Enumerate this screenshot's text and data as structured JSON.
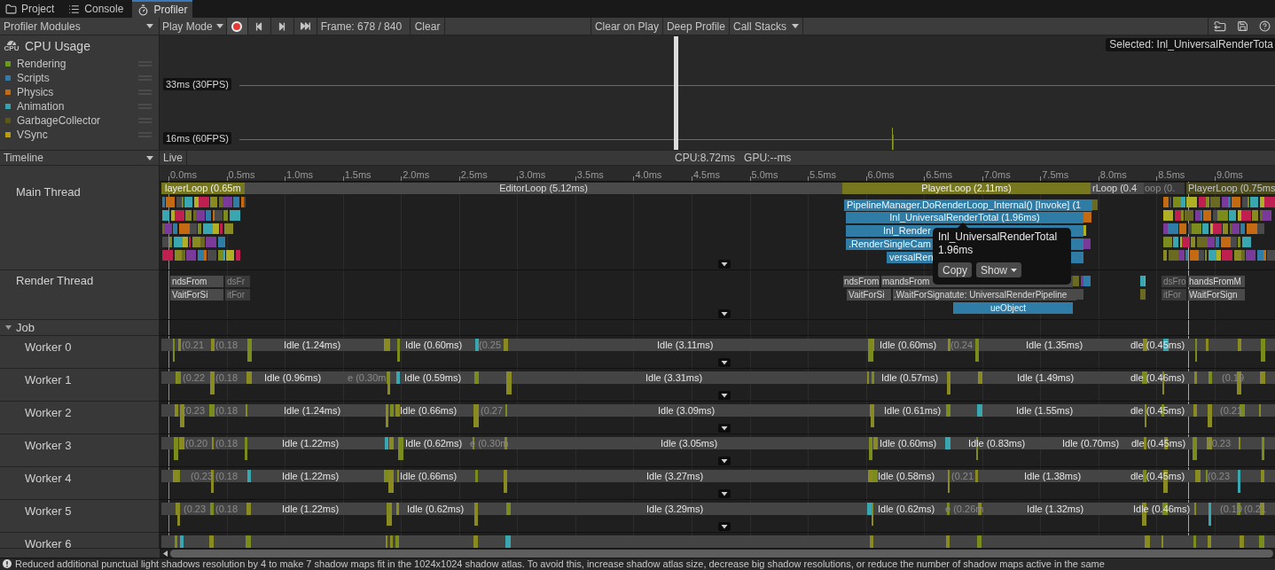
{
  "tabs": [
    {
      "label": "Project",
      "selected": false
    },
    {
      "label": "Console",
      "selected": false
    },
    {
      "label": "Profiler",
      "selected": true
    }
  ],
  "toolbar": {
    "modules": "Profiler Modules",
    "play_mode": "Play Mode",
    "record": {
      "on": true
    },
    "frame": "Frame: 678 / 840",
    "clear": "Clear",
    "buttons": [
      "Clear on Play",
      "Deep Profile"
    ],
    "call_stacks": "Call Stacks"
  },
  "cpu_module": {
    "icon_label": "CPU",
    "title": "CPU Usage",
    "categories": [
      {
        "name": "Rendering",
        "color": "#6a9a1c"
      },
      {
        "name": "Scripts",
        "color": "#2f7cab"
      },
      {
        "name": "Physics",
        "color": "#c46a12"
      },
      {
        "name": "Animation",
        "color": "#35a2ad"
      },
      {
        "name": "GarbageCollector",
        "color": "#5a5a16"
      },
      {
        "name": "VSync",
        "color": "#b89c14"
      }
    ]
  },
  "chart": {
    "markers": [
      "33ms (30FPS)",
      "16ms (60FPS)"
    ],
    "selected": "Selected: Inl_UniversalRenderTota"
  },
  "timeline": {
    "view": "Timeline",
    "mode": "Live",
    "cpu": "CPU:8.72ms",
    "gpu": "GPU:--ms",
    "ticks": [
      "0.0ms",
      "0.5ms",
      "1.0ms",
      "1.5ms",
      "2.0ms",
      "2.5ms",
      "3.0ms",
      "3.5ms",
      "4.0ms",
      "4.5ms",
      "5.0ms",
      "5.5ms",
      "6.0ms",
      "6.5ms",
      "7.0ms",
      "7.5ms",
      "8.0ms",
      "8.5ms",
      "9.0ms"
    ]
  },
  "threads": [
    {
      "name": "Main Thread",
      "rows": [
        {
          "blocks": [
            {
              "label": "layerLoop (0.65m",
              "kind": "player"
            },
            {
              "label": "EditorLoop (5.12ms)",
              "kind": "editor"
            },
            {
              "label": "PlayerLoop (2.11ms)",
              "kind": "player"
            },
            {
              "label": "rLoop (0.4",
              "kind": "editor"
            },
            {
              "label": "oop (0.",
              "kind": "dim"
            },
            {
              "label": "PlayerLoop (0.75ms",
              "kind": "faded"
            }
          ]
        },
        {
          "blocks": [
            {
              "label": "PipelineManager.DoRenderLoop_Internal() [Invoke] (1",
              "kind": "render"
            }
          ]
        },
        {
          "blocks": [
            {
              "label": "Inl_UniversalRenderTotal (1.96ms)",
              "kind": "render"
            }
          ]
        },
        {
          "blocks": [
            {
              "label": "Inl_Render",
              "kind": "render"
            }
          ]
        },
        {
          "blocks": [
            {
              "label": ".RenderSingleCam",
              "kind": "render"
            }
          ]
        },
        {
          "blocks": [
            {
              "label": "versalRen",
              "kind": "render"
            }
          ]
        }
      ]
    },
    {
      "name": "Render Thread",
      "rows": [
        {
          "blocks": [
            {
              "label": "ndsFrom",
              "kind": "editor"
            },
            {
              "label": "dsFr",
              "kind": "dim"
            },
            {
              "label": "ndsFrom",
              "kind": "editor"
            },
            {
              "label": "mandsFrom",
              "kind": "editor"
            },
            {
              "label": "dsFro",
              "kind": "dim"
            },
            {
              "label": "handsFromM",
              "kind": "editor"
            }
          ]
        },
        {
          "blocks": [
            {
              "label": "VaitForSi",
              "kind": "editor"
            },
            {
              "label": "itFor",
              "kind": "dim"
            },
            {
              "label": "VaitForSi",
              "kind": "editor"
            },
            {
              "label": ".WaitForSignatute: UniversalRenderPipeline",
              "kind": "editor"
            },
            {
              "label": "itFor",
              "kind": "dim"
            },
            {
              "label": "WaitForSign",
              "kind": "editor"
            }
          ]
        },
        {
          "blocks": [
            {
              "label": "ueObject",
              "kind": "render"
            }
          ]
        }
      ]
    }
  ],
  "job": {
    "name": "Job",
    "expanded": true,
    "workers": [
      {
        "name": "Worker 0",
        "labels": [
          {
            "text": "(0.21",
            "kind": "dim"
          },
          {
            "text": "(0.18",
            "kind": "dim"
          },
          {
            "text": "Idle (1.24ms)",
            "kind": "idle"
          },
          {
            "text": "Idle (0.60ms)",
            "kind": "idle"
          },
          {
            "text": "(0.25",
            "kind": "dim"
          },
          {
            "text": "Idle (3.11ms)",
            "kind": "idle"
          },
          {
            "text": "Idle (0.60ms)",
            "kind": "idle"
          },
          {
            "text": "(0.24",
            "kind": "dim"
          },
          {
            "text": "Idle (1.35ms)",
            "kind": "idle"
          },
          {
            "text": "dle (0.45ms)",
            "kind": "idle"
          }
        ]
      },
      {
        "name": "Worker 1",
        "labels": [
          {
            "text": "(0.22",
            "kind": "dim"
          },
          {
            "text": "(0.18",
            "kind": "dim"
          },
          {
            "text": "Idle (0.96ms)",
            "kind": "idle"
          },
          {
            "text": "e (0.30m",
            "kind": "dim"
          },
          {
            "text": "Idle (0.59ms)",
            "kind": "idle"
          },
          {
            "text": "Idle (3.31ms)",
            "kind": "idle"
          },
          {
            "text": "Idle (0.57ms)",
            "kind": "idle"
          },
          {
            "text": "Idle (1.49ms)",
            "kind": "idle"
          },
          {
            "text": "dle (0.46ms)",
            "kind": "idle"
          },
          {
            "text": "(0.19",
            "kind": "dim"
          }
        ]
      },
      {
        "name": "Worker 2",
        "labels": [
          {
            "text": "(0.23",
            "kind": "dim"
          },
          {
            "text": "(0.18",
            "kind": "dim"
          },
          {
            "text": "Idle (1.24ms)",
            "kind": "idle"
          },
          {
            "text": "Idle (0.66ms)",
            "kind": "idle"
          },
          {
            "text": "(0.27",
            "kind": "dim"
          },
          {
            "text": "Idle (3.09ms)",
            "kind": "idle"
          },
          {
            "text": "Idle (0.61ms)",
            "kind": "idle"
          },
          {
            "text": "Idle (1.55ms)",
            "kind": "idle"
          },
          {
            "text": "dle (0.45ms)",
            "kind": "idle"
          },
          {
            "text": "(0.21",
            "kind": "dim"
          }
        ]
      },
      {
        "name": "Worker 3",
        "labels": [
          {
            "text": "(0.20",
            "kind": "dim"
          },
          {
            "text": "(0.18",
            "kind": "dim"
          },
          {
            "text": "Idle (1.22ms)",
            "kind": "idle"
          },
          {
            "text": "Idle (0.62ms)",
            "kind": "idle"
          },
          {
            "text": "e (0.30m",
            "kind": "dim"
          },
          {
            "text": "Idle (3.05ms)",
            "kind": "idle"
          },
          {
            "text": "Idle (0.60ms)",
            "kind": "idle"
          },
          {
            "text": "Idle (0.83ms)",
            "kind": "idle"
          },
          {
            "text": "Idle (0.70ms)",
            "kind": "idle"
          },
          {
            "text": "dle (0.45ms)",
            "kind": "idle"
          },
          {
            "text": "(0.23",
            "kind": "dim"
          }
        ]
      },
      {
        "name": "Worker 4",
        "labels": [
          {
            "text": "(0.23",
            "kind": "dim"
          },
          {
            "text": "(0.18",
            "kind": "dim"
          },
          {
            "text": "Idle (1.22ms)",
            "kind": "idle"
          },
          {
            "text": "Idle (0.66ms)",
            "kind": "idle"
          },
          {
            "text": "Idle (3.27ms)",
            "kind": "idle"
          },
          {
            "text": "Idle (0.58ms)",
            "kind": "idle"
          },
          {
            "text": "(0.21",
            "kind": "dim"
          },
          {
            "text": "Idle (1.38ms)",
            "kind": "idle"
          },
          {
            "text": "dle (0.45ms)",
            "kind": "idle"
          },
          {
            "text": "(0.23",
            "kind": "dim"
          }
        ]
      },
      {
        "name": "Worker 5",
        "labels": [
          {
            "text": "(0.23",
            "kind": "dim"
          },
          {
            "text": "(0.18",
            "kind": "dim"
          },
          {
            "text": "Idle (1.22ms)",
            "kind": "idle"
          },
          {
            "text": "Idle (0.62ms)",
            "kind": "idle"
          },
          {
            "text": "Idle (3.29ms)",
            "kind": "idle"
          },
          {
            "text": "Idle (0.62ms)",
            "kind": "idle"
          },
          {
            "text": "e (0.26m",
            "kind": "dim"
          },
          {
            "text": "Idle (1.32ms)",
            "kind": "idle"
          },
          {
            "text": "Idle (0.46ms)",
            "kind": "idle"
          },
          {
            "text": "(0.19",
            "kind": "dim"
          },
          {
            "text": "(0.21",
            "kind": "dim"
          }
        ]
      },
      {
        "name": "Worker 6"
      }
    ]
  },
  "tooltip": {
    "title": "Inl_UniversalRenderTotal",
    "value": "1.96ms",
    "buttons": [
      "Copy",
      "Show"
    ]
  },
  "status": {
    "message": "Reduced additional punctual light shadows resolution by 4 to make 7 shadow maps fit in the 1024x1024 shadow atlas. To avoid this, increase shadow atlas size, decrease big shadow resolutions, or reduce the number of shadow maps active in the same"
  }
}
